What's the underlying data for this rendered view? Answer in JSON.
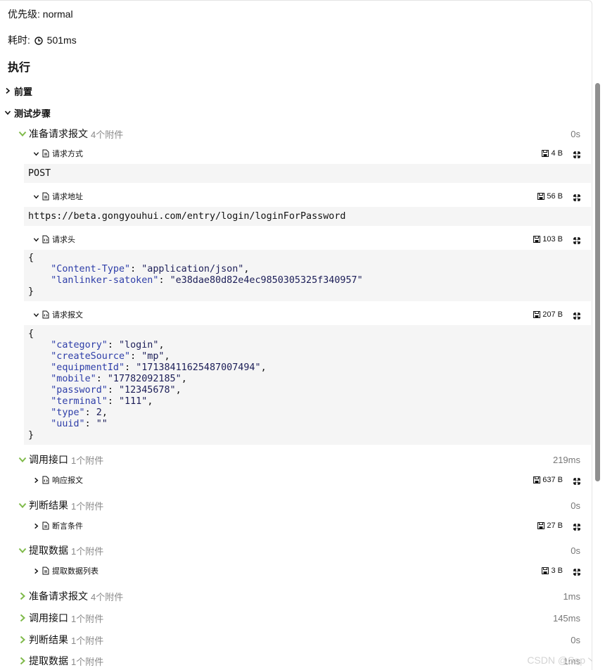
{
  "meta": {
    "priority": "优先级: normal",
    "duration_label": "耗时:",
    "duration_value": "501ms"
  },
  "execution": {
    "heading": "执行",
    "pre_section": "前置",
    "steps_section": "测试步骤"
  },
  "steps_expanded": [
    {
      "label": "准备请求报文",
      "count": "4个附件",
      "time": "0s",
      "attachments": [
        {
          "label": "请求方式",
          "size": "4 B",
          "body": "POST"
        },
        {
          "label": "请求地址",
          "size": "56 B",
          "body": "https://beta.gongyouhui.com/entry/login/loginForPassword"
        },
        {
          "label": "请求头",
          "size": "103 B"
        },
        {
          "label": "请求报文",
          "size": "207 B"
        }
      ]
    },
    {
      "label": "调用接口",
      "count": "1个附件",
      "time": "219ms",
      "attachments": [
        {
          "label": "响应报文",
          "size": "637 B"
        }
      ]
    },
    {
      "label": "判断结果",
      "count": "1个附件",
      "time": "0s",
      "attachments": [
        {
          "label": "断言条件",
          "size": "27 B"
        }
      ]
    },
    {
      "label": "提取数据",
      "count": "1个附件",
      "time": "0s",
      "attachments": [
        {
          "label": "提取数据列表",
          "size": "3 B"
        }
      ]
    }
  ],
  "headers_json": {
    "Content-Type": "application/json",
    "lanlinker-satoken": "e38dae80d82e4ec9850305325f340957"
  },
  "body_json": {
    "category": "login",
    "createSource": "mp",
    "equipmentId": "17138411625487007494",
    "mobile": "17782092185",
    "password": "12345678",
    "terminal": "111",
    "type": 2,
    "uuid": ""
  },
  "steps_collapsed": [
    {
      "label": "准备请求报文",
      "count": "4个附件",
      "time": "1ms"
    },
    {
      "label": "调用接口",
      "count": "1个附件",
      "time": "145ms"
    },
    {
      "label": "判断结果",
      "count": "1个附件",
      "time": "0s"
    },
    {
      "label": "提取数据",
      "count": "1个附件",
      "time": "1ms"
    }
  ],
  "watermark": "CSDN @Sap丶",
  "colors": {
    "chevron_green": "#7fba4a",
    "code_bg": "#f5f5f5",
    "json_key": "#2d3da8",
    "json_value": "#1b1d57"
  }
}
